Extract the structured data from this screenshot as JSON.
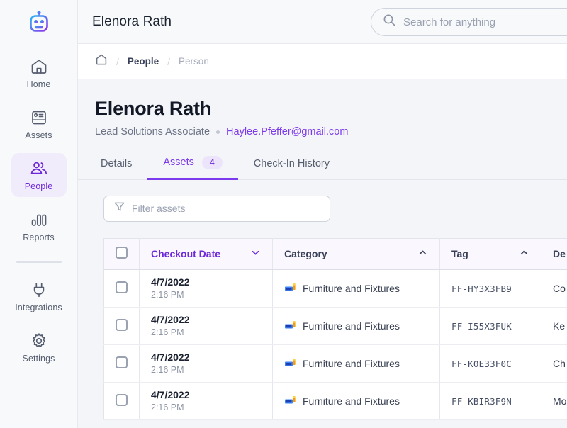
{
  "sidebar": {
    "logo_icon": "robot-logo-icon",
    "items": [
      {
        "label": "Home",
        "icon": "home-icon",
        "active": false
      },
      {
        "label": "Assets",
        "icon": "assets-monitor-icon",
        "active": false
      },
      {
        "label": "People",
        "icon": "people-icon",
        "active": true
      },
      {
        "label": "Reports",
        "icon": "reports-bar-chart-icon",
        "active": false
      }
    ],
    "items_secondary": [
      {
        "label": "Integrations",
        "icon": "plug-icon",
        "active": false
      },
      {
        "label": "Settings",
        "icon": "gear-icon",
        "active": false
      }
    ]
  },
  "topbar": {
    "title": "Elenora Rath",
    "search_placeholder": "Search for anything",
    "search_value": "",
    "search_icon": "search-icon"
  },
  "breadcrumb": {
    "home_icon": "home-outline-icon",
    "separator": "/",
    "items": [
      {
        "label": "People",
        "muted": false
      },
      {
        "label": "Person",
        "muted": true
      }
    ]
  },
  "person": {
    "name": "Elenora Rath",
    "role": "Lead Solutions Associate",
    "email": "Haylee.Pfeffer@gmail.com"
  },
  "tabs": [
    {
      "label": "Details",
      "badge": null,
      "active": false
    },
    {
      "label": "Assets",
      "badge": "4",
      "active": true
    },
    {
      "label": "Check-In History",
      "badge": null,
      "active": false
    }
  ],
  "filter": {
    "placeholder": "Filter assets",
    "value": "",
    "icon": "funnel-filter-icon"
  },
  "table": {
    "select_all_checkbox": "unchecked",
    "columns": [
      {
        "label": "Checkout Date",
        "sort": "desc",
        "sort_icon": "chevron-down-icon",
        "sorted": true
      },
      {
        "label": "Category",
        "sort": "asc",
        "sort_icon": "chevron-up-icon",
        "sorted": false
      },
      {
        "label": "Tag",
        "sort": "asc",
        "sort_icon": "chevron-up-icon",
        "sorted": false
      },
      {
        "label": "De",
        "sort": null,
        "sort_icon": null,
        "sorted": false
      }
    ],
    "rows": [
      {
        "checkbox": "unchecked",
        "date": "4/7/2022",
        "time": "2:16 PM",
        "category_icon": "furniture-icon",
        "category": "Furniture and Fixtures",
        "tag": "FF-HY3X3FB9",
        "description": "Co"
      },
      {
        "checkbox": "unchecked",
        "date": "4/7/2022",
        "time": "2:16 PM",
        "category_icon": "furniture-icon",
        "category": "Furniture and Fixtures",
        "tag": "FF-I55X3FUK",
        "description": "Ke"
      },
      {
        "checkbox": "unchecked",
        "date": "4/7/2022",
        "time": "2:16 PM",
        "category_icon": "furniture-icon",
        "category": "Furniture and Fixtures",
        "tag": "FF-K0E33F0C",
        "description": "Ch"
      },
      {
        "checkbox": "unchecked",
        "date": "4/7/2022",
        "time": "2:16 PM",
        "category_icon": "furniture-icon",
        "category": "Furniture and Fixtures",
        "tag": "FF-KBIR3F9N",
        "description": "Mo"
      }
    ]
  },
  "colors": {
    "accent": "#7c3aed",
    "accent_dark": "#6d28d9",
    "sidebar_bg": "#f8f9fb",
    "content_bg": "#f4f5f8",
    "border": "#e1e4ea",
    "text": "#1c2330",
    "muted": "#8d94a5"
  }
}
